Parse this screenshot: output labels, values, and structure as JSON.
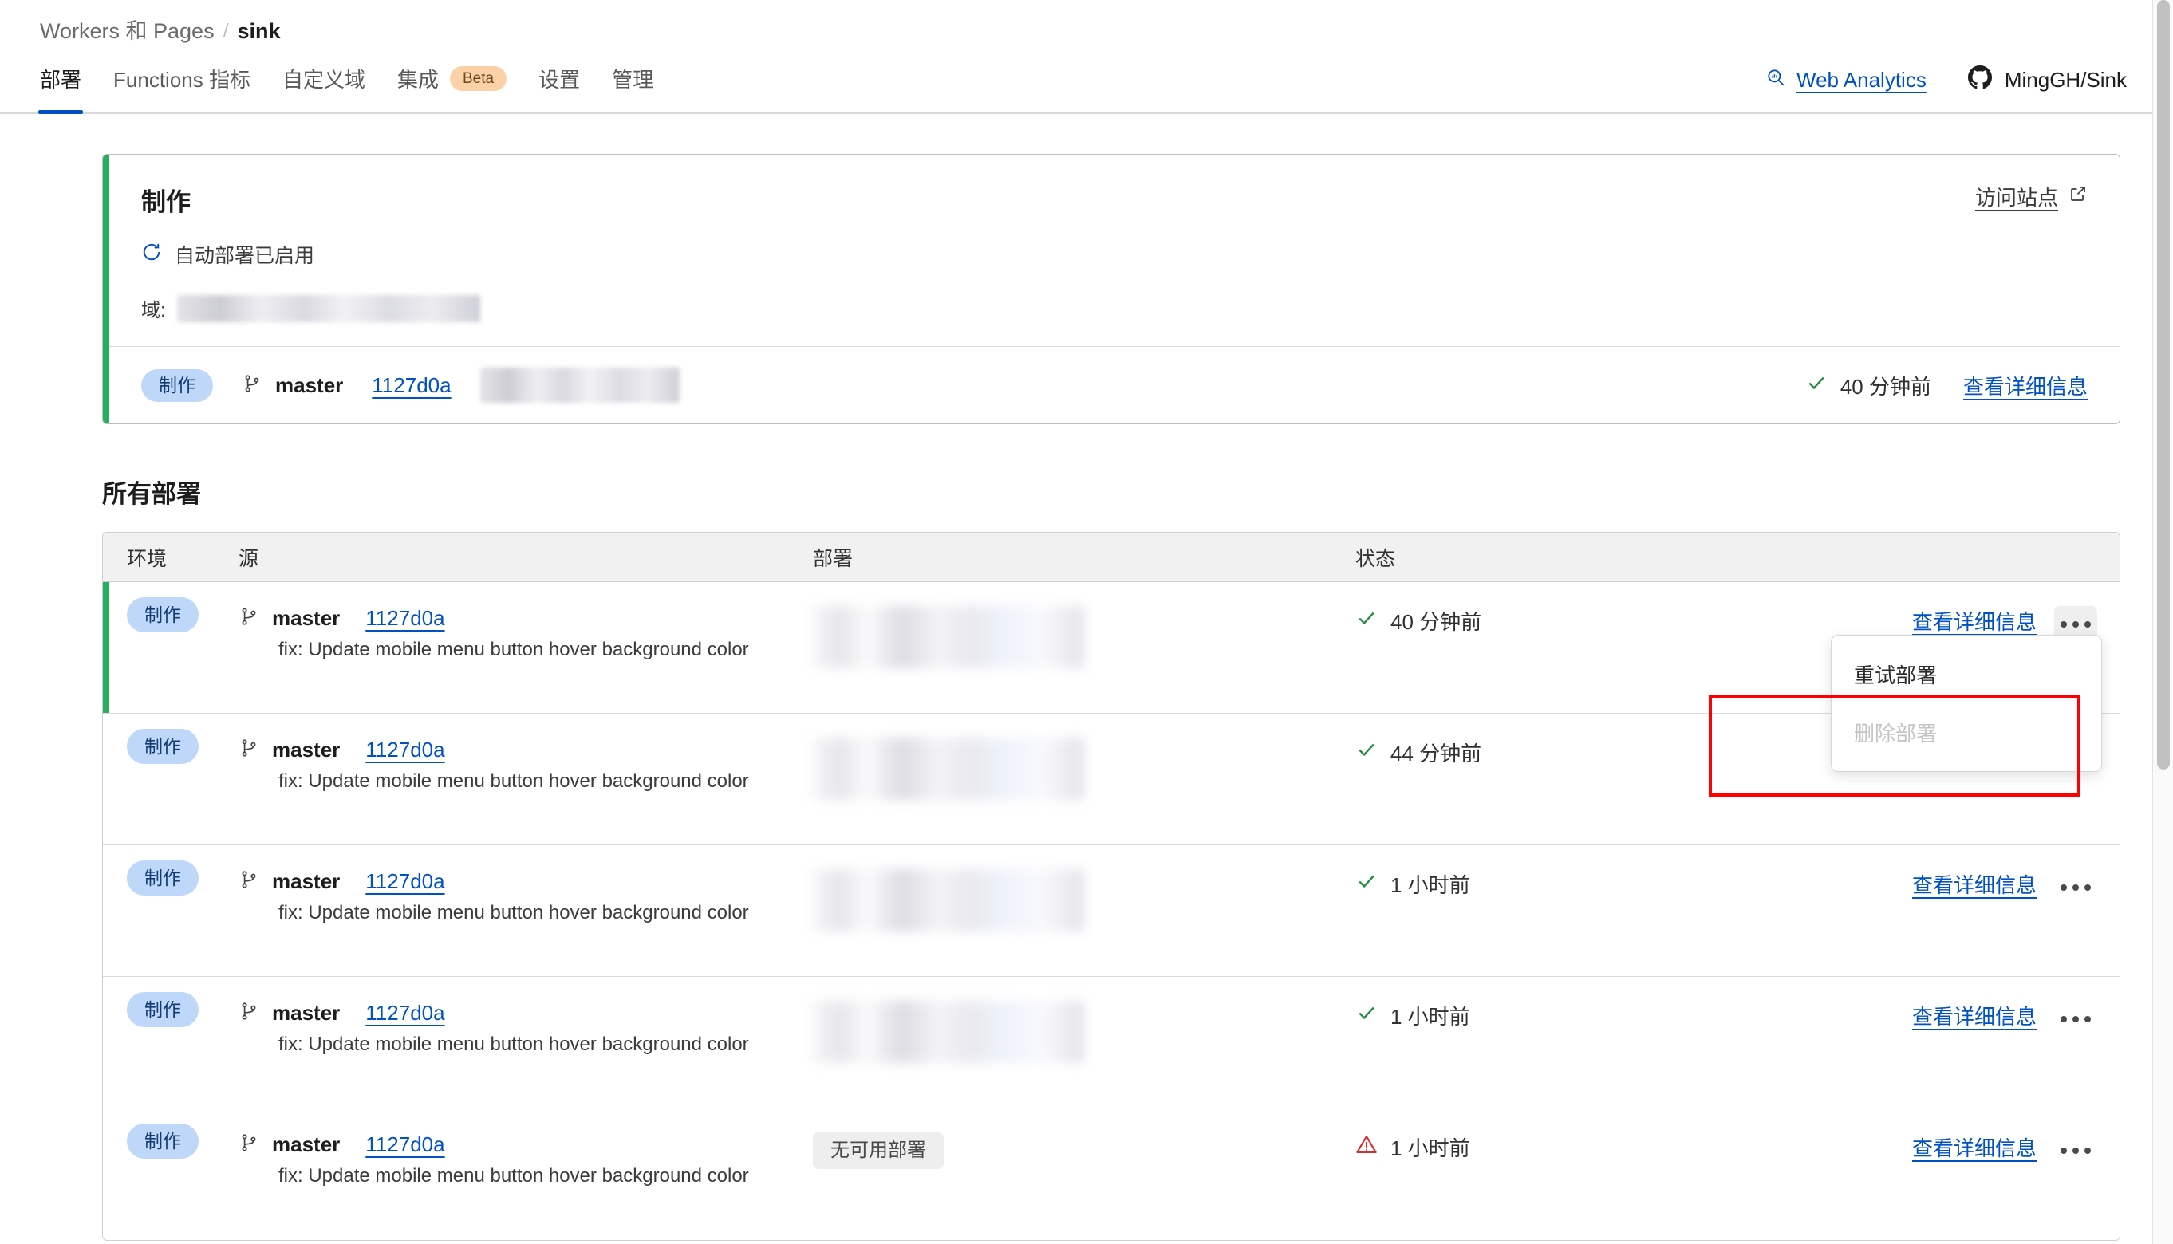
{
  "breadcrumb": {
    "root": "Workers 和 Pages",
    "separator": "/",
    "current": "sink"
  },
  "tabs": [
    {
      "label": "部署",
      "active": true,
      "badge": null
    },
    {
      "label": "Functions 指标",
      "active": false,
      "badge": null
    },
    {
      "label": "自定义域",
      "active": false,
      "badge": null
    },
    {
      "label": "集成",
      "active": false,
      "badge": "Beta"
    },
    {
      "label": "设置",
      "active": false,
      "badge": null
    },
    {
      "label": "管理",
      "active": false,
      "badge": null
    }
  ],
  "header_right": {
    "analytics_label": "Web Analytics",
    "analytics_icon": "analytics-search-icon",
    "repo_label": "MingGH/Sink",
    "repo_icon": "github-icon"
  },
  "production_card": {
    "title": "制作",
    "visit_site_label": "访问站点",
    "visit_site_icon": "external-link-icon",
    "auto_deploy_label": "自动部署已启用",
    "auto_deploy_icon": "refresh-icon",
    "domain_label": "域:",
    "domain_value_redacted": true,
    "footer": {
      "environment": "制作",
      "branch_icon": "git-branch-icon",
      "branch": "master",
      "commit": "1127d0a",
      "deployment_redacted": true,
      "status_icon": "check-icon",
      "status_time": "40 分钟前",
      "detail_label": "查看详细信息"
    }
  },
  "all_deployments": {
    "section_title": "所有部署",
    "columns": [
      "环境",
      "源",
      "部署",
      "状态"
    ],
    "rows": [
      {
        "environment": "制作",
        "branch": "master",
        "commit": "1127d0a",
        "commit_message": "fix: Update mobile menu button hover background color",
        "deployment_redacted": true,
        "deployment_text": null,
        "status_icon": "check-icon",
        "status_time": "40 分钟前",
        "detail_label": "查看详细信息",
        "kebab_label": "…",
        "is_current": true,
        "menu_open": true
      },
      {
        "environment": "制作",
        "branch": "master",
        "commit": "1127d0a",
        "commit_message": "fix: Update mobile menu button hover background color",
        "deployment_redacted": true,
        "deployment_text": null,
        "status_icon": "check-icon",
        "status_time": "44 分钟前",
        "detail_label": "查看详细信息",
        "kebab_label": "…",
        "is_current": false,
        "menu_open": false
      },
      {
        "environment": "制作",
        "branch": "master",
        "commit": "1127d0a",
        "commit_message": "fix: Update mobile menu button hover background color",
        "deployment_redacted": true,
        "deployment_text": null,
        "status_icon": "check-icon",
        "status_time": "1 小时前",
        "detail_label": "查看详细信息",
        "kebab_label": "…",
        "is_current": false,
        "menu_open": false
      },
      {
        "environment": "制作",
        "branch": "master",
        "commit": "1127d0a",
        "commit_message": "fix: Update mobile menu button hover background color",
        "deployment_redacted": true,
        "deployment_text": null,
        "status_icon": "check-icon",
        "status_time": "1 小时前",
        "detail_label": "查看详细信息",
        "kebab_label": "…",
        "is_current": false,
        "menu_open": false
      },
      {
        "environment": "制作",
        "branch": "master",
        "commit": "1127d0a",
        "commit_message": "fix: Update mobile menu button hover background color",
        "deployment_redacted": false,
        "deployment_text": "无可用部署",
        "status_icon": "warning-icon",
        "status_time": "1 小时前",
        "detail_label": "查看详细信息",
        "kebab_label": "…",
        "is_current": false,
        "menu_open": false
      }
    ],
    "dropdown_menu": {
      "items": [
        {
          "label": "重试部署",
          "disabled": false
        },
        {
          "label": "删除部署",
          "disabled": true
        }
      ]
    }
  },
  "colors": {
    "accent_blue": "#0051c3",
    "success_green": "#27ae60",
    "check_green": "#1e8e3e",
    "warning_red": "#d32f2f",
    "badge_blue_bg": "#bfd7f9",
    "badge_blue_text": "#123c72",
    "beta_badge_bg": "#fbd2a8",
    "annotation_red": "#ff0000",
    "table_header_bg": "#f1f1f1"
  }
}
